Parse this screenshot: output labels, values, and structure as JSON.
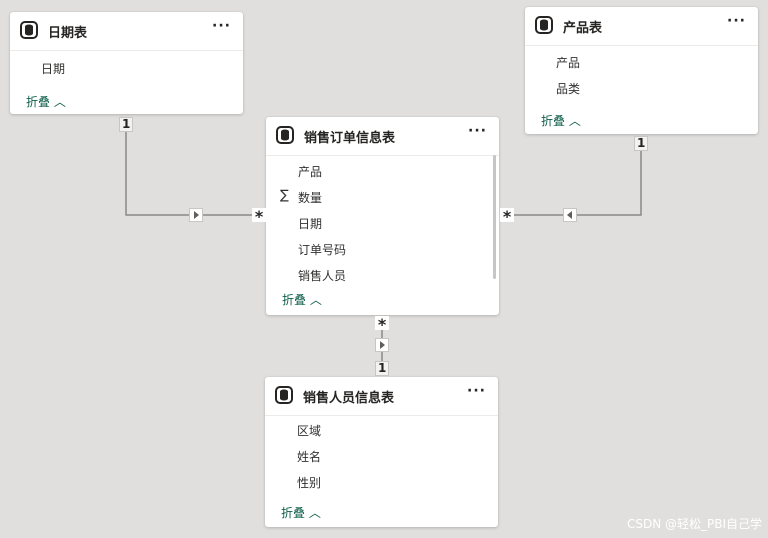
{
  "tables": {
    "date": {
      "title": "日期表",
      "fields": [
        "日期"
      ],
      "collapse": "折叠"
    },
    "product": {
      "title": "产品表",
      "fields": [
        "产品",
        "品类"
      ],
      "collapse": "折叠"
    },
    "orders": {
      "title": "销售订单信息表",
      "fields": [
        "产品",
        "数量",
        "日期",
        "订单号码",
        "销售人员"
      ],
      "measure_symbol": "∑",
      "collapse": "折叠"
    },
    "salesperson": {
      "title": "销售人员信息表",
      "fields": [
        "区域",
        "姓名",
        "性别"
      ],
      "collapse": "折叠"
    }
  },
  "relationships": {
    "one_label": "1",
    "many_label": "*",
    "items": [
      {
        "from": "日期表",
        "to": "销售订单信息表",
        "from_card": "1",
        "to_card": "*"
      },
      {
        "from": "产品表",
        "to": "销售订单信息表",
        "from_card": "1",
        "to_card": "*"
      },
      {
        "from": "销售人员信息表",
        "to": "销售订单信息表",
        "from_card": "1",
        "to_card": "*"
      }
    ]
  },
  "more_label": "···",
  "watermark": "CSDN @轻松_PBI自己学",
  "colors": {
    "canvas": "#e1dfdd",
    "card": "#ffffff",
    "link": "#0e5e4a",
    "line": "#8a8886"
  }
}
